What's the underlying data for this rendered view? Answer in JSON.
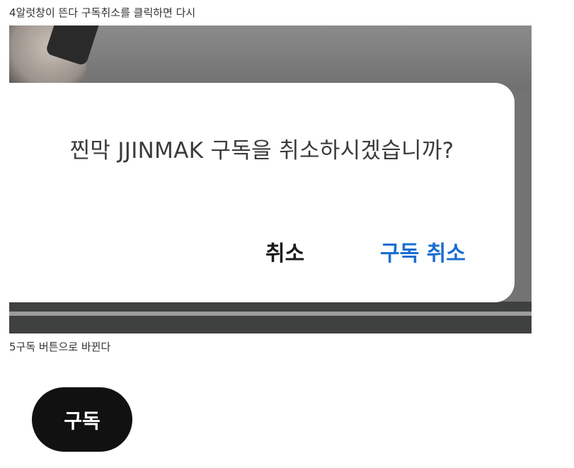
{
  "captions": {
    "step4": "4알럿창이 뜬다 구독취소를 클릭하면 다시",
    "step5": "5구독 버튼으로 바뀐다"
  },
  "dialog": {
    "message": "찐막 JJINMAK 구독을 취소하시겠습니까?",
    "cancel_label": "취소",
    "confirm_label": "구독 취소"
  },
  "subscribe_button": {
    "label": "구독"
  },
  "colors": {
    "confirm_accent": "#1a6fd0",
    "subscribe_bg": "#111111",
    "dialog_bg": "#ffffff"
  }
}
